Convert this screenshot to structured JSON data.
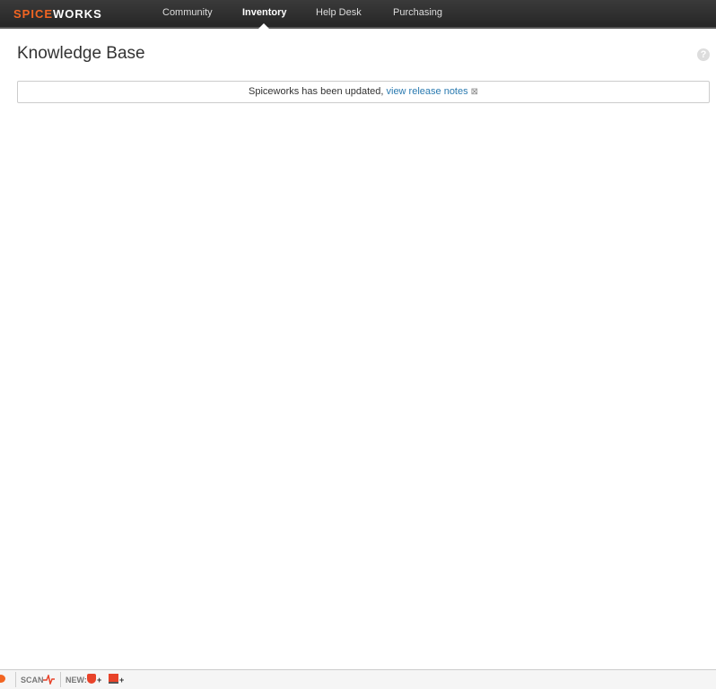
{
  "brand": {
    "part1": "SPICE",
    "part2": "WORKS"
  },
  "nav": [
    "Community",
    "Inventory",
    "Help Desk",
    "Purchasing"
  ],
  "page_title": "Knowledge Base",
  "help": "?",
  "notice": {
    "text": "Spiceworks has been updated, ",
    "link": "view release notes",
    "close": "⊠"
  },
  "toolbar": {
    "scan": "SCAN",
    "new": "NEW:",
    "plus": "+"
  },
  "colors": {
    "brand": "#f26522",
    "link": "#2a7ab0"
  }
}
